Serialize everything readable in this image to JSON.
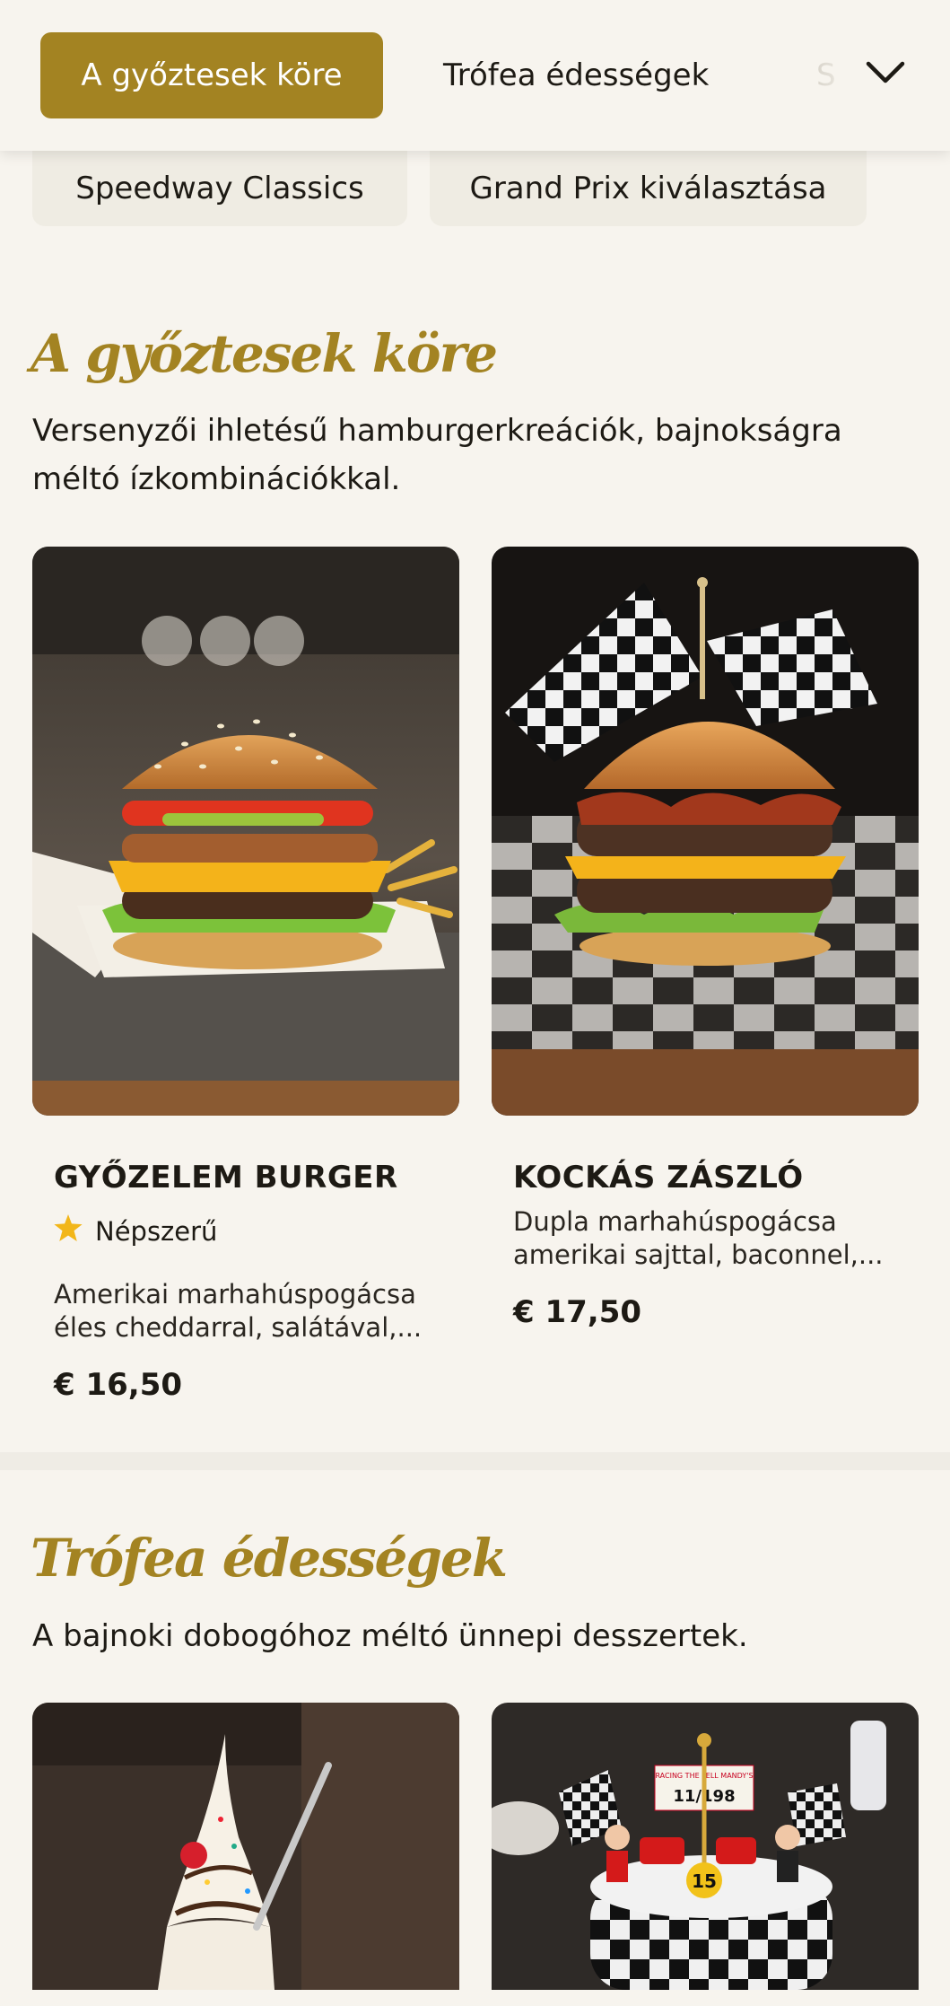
{
  "nav": {
    "tabs": [
      "A győztesek köre",
      "Trófea édességek",
      "S"
    ],
    "active_index": 0,
    "expand_icon": "chevron-down-icon"
  },
  "subnav": {
    "chips": [
      "Speedway Classics",
      "Grand Prix kiválasztása"
    ]
  },
  "sections": [
    {
      "title": "A győztesek köre",
      "description": "Versenyzői ihletésű hamburgerkreációk, bajnokságra méltó ízkombinációkkal.",
      "items": [
        {
          "name": "GYŐZELEM BURGER",
          "badge": "Népszerű",
          "badge_icon": "star-icon",
          "description": "Amerikai marhahúspogácsa éles cheddarral, salátával,...",
          "price": "€ 16,50"
        },
        {
          "name": "KOCKÁS ZÁSZLÓ",
          "description": "Dupla marhahúspogácsa amerikai sajttal, baconnel,...",
          "price": "€ 17,50"
        }
      ]
    },
    {
      "title": "Trófea édességek",
      "description": "A bajnoki dobogóhoz méltó ünnepi desszertek.",
      "items": [
        {
          "image_text_1": "RACING THE FELL MANDY'S",
          "image_text_2": "11/198",
          "image_text_3": "15"
        }
      ]
    }
  ],
  "colors": {
    "accent": "#a38322",
    "background": "#f7f4ee",
    "chip": "#efece3",
    "star": "#f2b619"
  }
}
